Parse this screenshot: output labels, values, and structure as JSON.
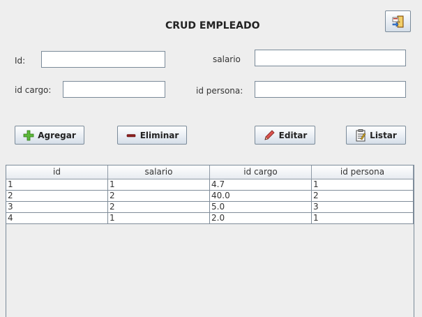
{
  "title": "CRUD EMPLEADO",
  "form": {
    "id": {
      "label": "Id:",
      "value": ""
    },
    "salario": {
      "label": "salario",
      "value": ""
    },
    "id_cargo": {
      "label": "id cargo:",
      "value": ""
    },
    "id_persona": {
      "label": "id persona:",
      "value": ""
    }
  },
  "buttons": {
    "agregar": "Agregar",
    "eliminar": "Eliminar",
    "editar": "Editar",
    "listar": "Listar"
  },
  "icons": {
    "agregar": "plus-icon",
    "eliminar": "minus-icon",
    "editar": "pencil-icon",
    "listar": "list-icon",
    "exit": "exit-door-icon"
  },
  "table": {
    "columns": [
      "id",
      "salario",
      "id cargo",
      "id persona"
    ],
    "rows": [
      [
        "1",
        "1",
        "4.7",
        "1"
      ],
      [
        "2",
        "2",
        "40.0",
        "2"
      ],
      [
        "3",
        "2",
        "5.0",
        "3"
      ],
      [
        "4",
        "1",
        "2.0",
        "1"
      ]
    ]
  }
}
